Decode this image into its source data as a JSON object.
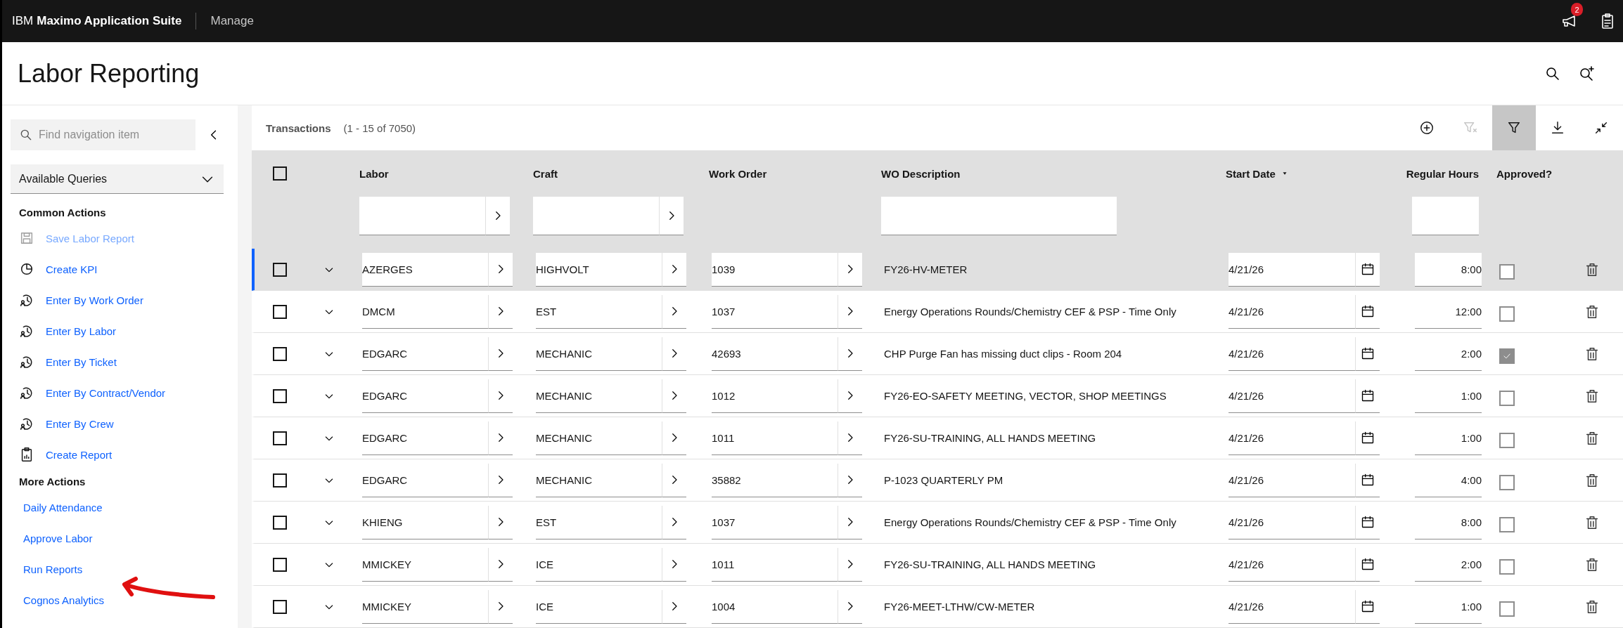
{
  "top_bar": {
    "brand_prefix": "IBM",
    "brand_name": "Maximo Application Suite",
    "app": "Manage",
    "notification_count": "2"
  },
  "page": {
    "title": "Labor Reporting"
  },
  "sidebar": {
    "search": {
      "placeholder": "Find navigation item"
    },
    "queries": {
      "label": "Available Queries"
    },
    "sections": [
      {
        "title": "Common Actions",
        "items": [
          {
            "label": "Save Labor Report",
            "kind": "save",
            "disabled": true
          },
          {
            "label": "Create KPI",
            "kind": "kpi",
            "disabled": false
          },
          {
            "label": "Enter By Work Order",
            "kind": "work-order",
            "disabled": false
          },
          {
            "label": "Enter By Labor",
            "kind": "labor",
            "disabled": false
          },
          {
            "label": "Enter By Ticket",
            "kind": "ticket",
            "disabled": false
          },
          {
            "label": "Enter By Contract/Vendor",
            "kind": "vendor",
            "disabled": false
          },
          {
            "label": "Enter By Crew",
            "kind": "crew",
            "disabled": false
          },
          {
            "label": "Create Report",
            "kind": "report",
            "disabled": false
          }
        ]
      },
      {
        "title": "More Actions",
        "items": [
          {
            "label": "Daily Attendance",
            "kind": "plain",
            "disabled": false
          },
          {
            "label": "Approve Labor",
            "kind": "plain",
            "disabled": false
          },
          {
            "label": "Run Reports",
            "kind": "plain",
            "disabled": false
          },
          {
            "label": "Cognos Analytics",
            "kind": "plain",
            "disabled": false
          }
        ]
      }
    ]
  },
  "table": {
    "title": "Transactions",
    "count": "(1 - 15 of 7050)",
    "toolbar": [
      {
        "kind": "add",
        "disabled": false,
        "selected": false
      },
      {
        "kind": "clear-filter",
        "disabled": true,
        "selected": false
      },
      {
        "kind": "filter",
        "disabled": false,
        "selected": true
      },
      {
        "kind": "download",
        "disabled": false,
        "selected": false
      },
      {
        "kind": "collapse",
        "disabled": false,
        "selected": false
      }
    ],
    "select_all": {
      "checked": false
    },
    "columns": [
      {
        "label": "Labor",
        "kind": "lookup"
      },
      {
        "label": "Craft",
        "kind": "lookup"
      },
      {
        "label": "Work Order",
        "kind": "plain"
      },
      {
        "label": "WO Description",
        "kind": "text"
      },
      {
        "label": "Start Date",
        "kind": "plain",
        "sorted": true
      },
      {
        "label": "Regular Hours",
        "kind": "text"
      },
      {
        "label": "Approved?",
        "kind": "plain"
      }
    ],
    "rows": [
      {
        "selected": true,
        "checked": false,
        "labor": "AZERGES",
        "craft": "HIGHVOLT",
        "work_order": "1039",
        "description": "FY26-HV-METER",
        "start_date": "4/21/26",
        "hours": "8:00",
        "approved": false
      },
      {
        "selected": false,
        "checked": false,
        "labor": "DMCM",
        "craft": "EST",
        "work_order": "1037",
        "description": "Energy Operations Rounds/Chemistry CEF & PSP - Time Only",
        "start_date": "4/21/26",
        "hours": "12:00",
        "approved": false
      },
      {
        "selected": false,
        "checked": false,
        "labor": "EDGARC",
        "craft": "MECHANIC",
        "work_order": "42693",
        "description": "CHP Purge Fan has missing duct clips - Room 204",
        "start_date": "4/21/26",
        "hours": "2:00",
        "approved": true
      },
      {
        "selected": false,
        "checked": false,
        "labor": "EDGARC",
        "craft": "MECHANIC",
        "work_order": "1012",
        "description": "FY26-EO-SAFETY MEETING, VECTOR, SHOP MEETINGS",
        "start_date": "4/21/26",
        "hours": "1:00",
        "approved": false
      },
      {
        "selected": false,
        "checked": false,
        "labor": "EDGARC",
        "craft": "MECHANIC",
        "work_order": "1011",
        "description": "FY26-SU-TRAINING, ALL HANDS MEETING",
        "start_date": "4/21/26",
        "hours": "1:00",
        "approved": false
      },
      {
        "selected": false,
        "checked": false,
        "labor": "EDGARC",
        "craft": "MECHANIC",
        "work_order": "35882",
        "description": "P-1023 QUARTERLY PM",
        "start_date": "4/21/26",
        "hours": "4:00",
        "approved": false
      },
      {
        "selected": false,
        "checked": false,
        "labor": "KHIENG",
        "craft": "EST",
        "work_order": "1037",
        "description": "Energy Operations Rounds/Chemistry CEF & PSP - Time Only",
        "start_date": "4/21/26",
        "hours": "8:00",
        "approved": false
      },
      {
        "selected": false,
        "checked": false,
        "labor": "MMICKEY",
        "craft": "ICE",
        "work_order": "1011",
        "description": "FY26-SU-TRAINING, ALL HANDS MEETING",
        "start_date": "4/21/26",
        "hours": "2:00",
        "approved": false
      },
      {
        "selected": false,
        "checked": false,
        "labor": "MMICKEY",
        "craft": "ICE",
        "work_order": "1004",
        "description": "FY26-MEET-LTHW/CW-METER",
        "start_date": "4/21/26",
        "hours": "1:00",
        "approved": false
      }
    ]
  }
}
